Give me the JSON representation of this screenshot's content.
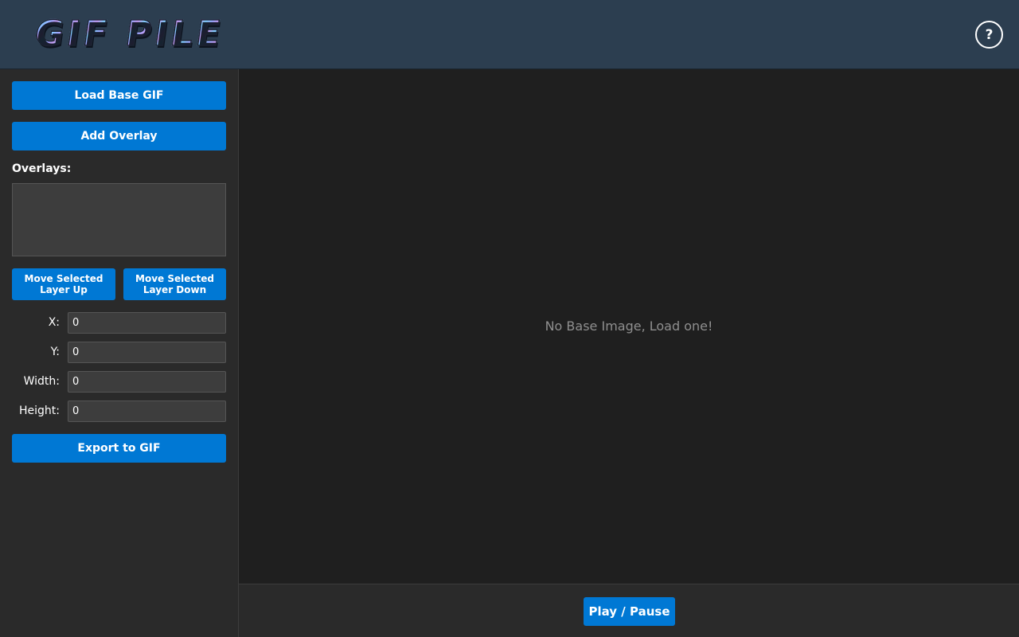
{
  "header": {
    "logo_text": "GIF PILE",
    "help_label": "?"
  },
  "sidebar": {
    "load_base_label": "Load Base GIF",
    "add_overlay_label": "Add Overlay",
    "overlays_label": "Overlays:",
    "move_up_label": "Move Selected Layer Up",
    "move_down_label": "Move Selected Layer Down",
    "fields": {
      "x": {
        "label": "X:",
        "value": "0"
      },
      "y": {
        "label": "Y:",
        "value": "0"
      },
      "width": {
        "label": "Width:",
        "value": "0"
      },
      "height": {
        "label": "Height:",
        "value": "0"
      }
    },
    "export_label": "Export to GIF"
  },
  "canvas": {
    "empty_message": "No Base Image, Load one!"
  },
  "footer": {
    "play_pause_label": "Play / Pause"
  },
  "colors": {
    "accent": "#0078d4",
    "header_bg": "#2c3e50",
    "sidebar_bg": "#2a2a2a",
    "canvas_bg": "#1f1f1f"
  }
}
